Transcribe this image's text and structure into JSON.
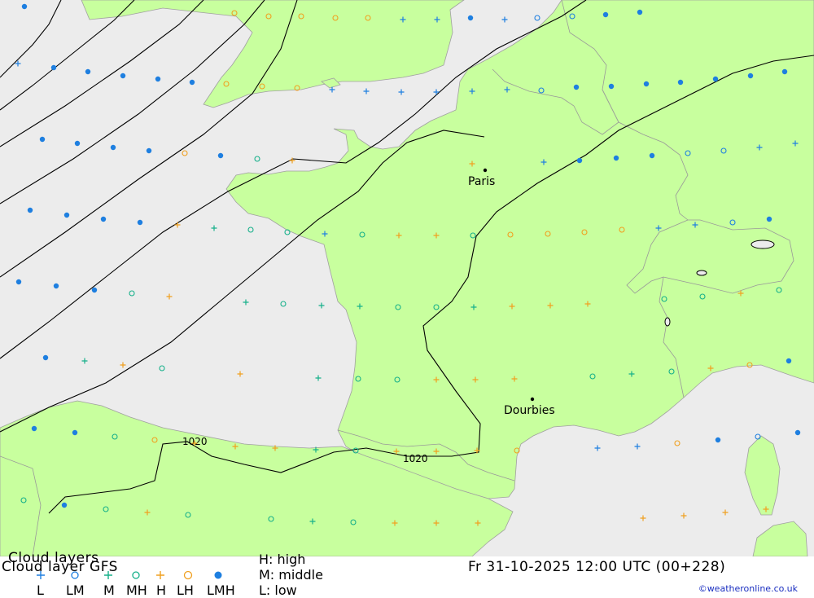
{
  "map": {
    "cities": [
      {
        "name": "Paris"
      },
      {
        "name": "Dourbies"
      }
    ],
    "isobar_labels": [
      "1020",
      "1020"
    ]
  },
  "legend": {
    "title": "Cloud layers",
    "subtitle": "Cloud layer  GFS",
    "symbols": [
      {
        "code": "L",
        "icon": "plus-marker",
        "color": "#1e7fe0"
      },
      {
        "code": "LM",
        "icon": "open-circle-marker",
        "color": "#1e7fe0"
      },
      {
        "code": "M",
        "icon": "plus-marker",
        "color": "#16b08a"
      },
      {
        "code": "MH",
        "icon": "open-circle-marker",
        "color": "#16b08a"
      },
      {
        "code": "H",
        "icon": "plus-marker",
        "color": "#f0a020"
      },
      {
        "code": "LH",
        "icon": "open-circle-marker",
        "color": "#f0a020"
      },
      {
        "code": "LMH",
        "icon": "filled-circle-marker",
        "color": "#1e7fe0"
      }
    ],
    "key_high": "H: high",
    "key_middle": "M: middle",
    "key_low": "L: low",
    "datetime": "Fr 31-10-2025 12:00 UTC (00+228)",
    "credit": "©weatheronline.co.uk"
  },
  "colors": {
    "land": "#c8ff9e",
    "sea": "#ececec",
    "border": "#9a9a9a",
    "isobar": "#000000",
    "low": "#1e7fe0",
    "middle": "#16b08a",
    "high": "#f0a020"
  }
}
